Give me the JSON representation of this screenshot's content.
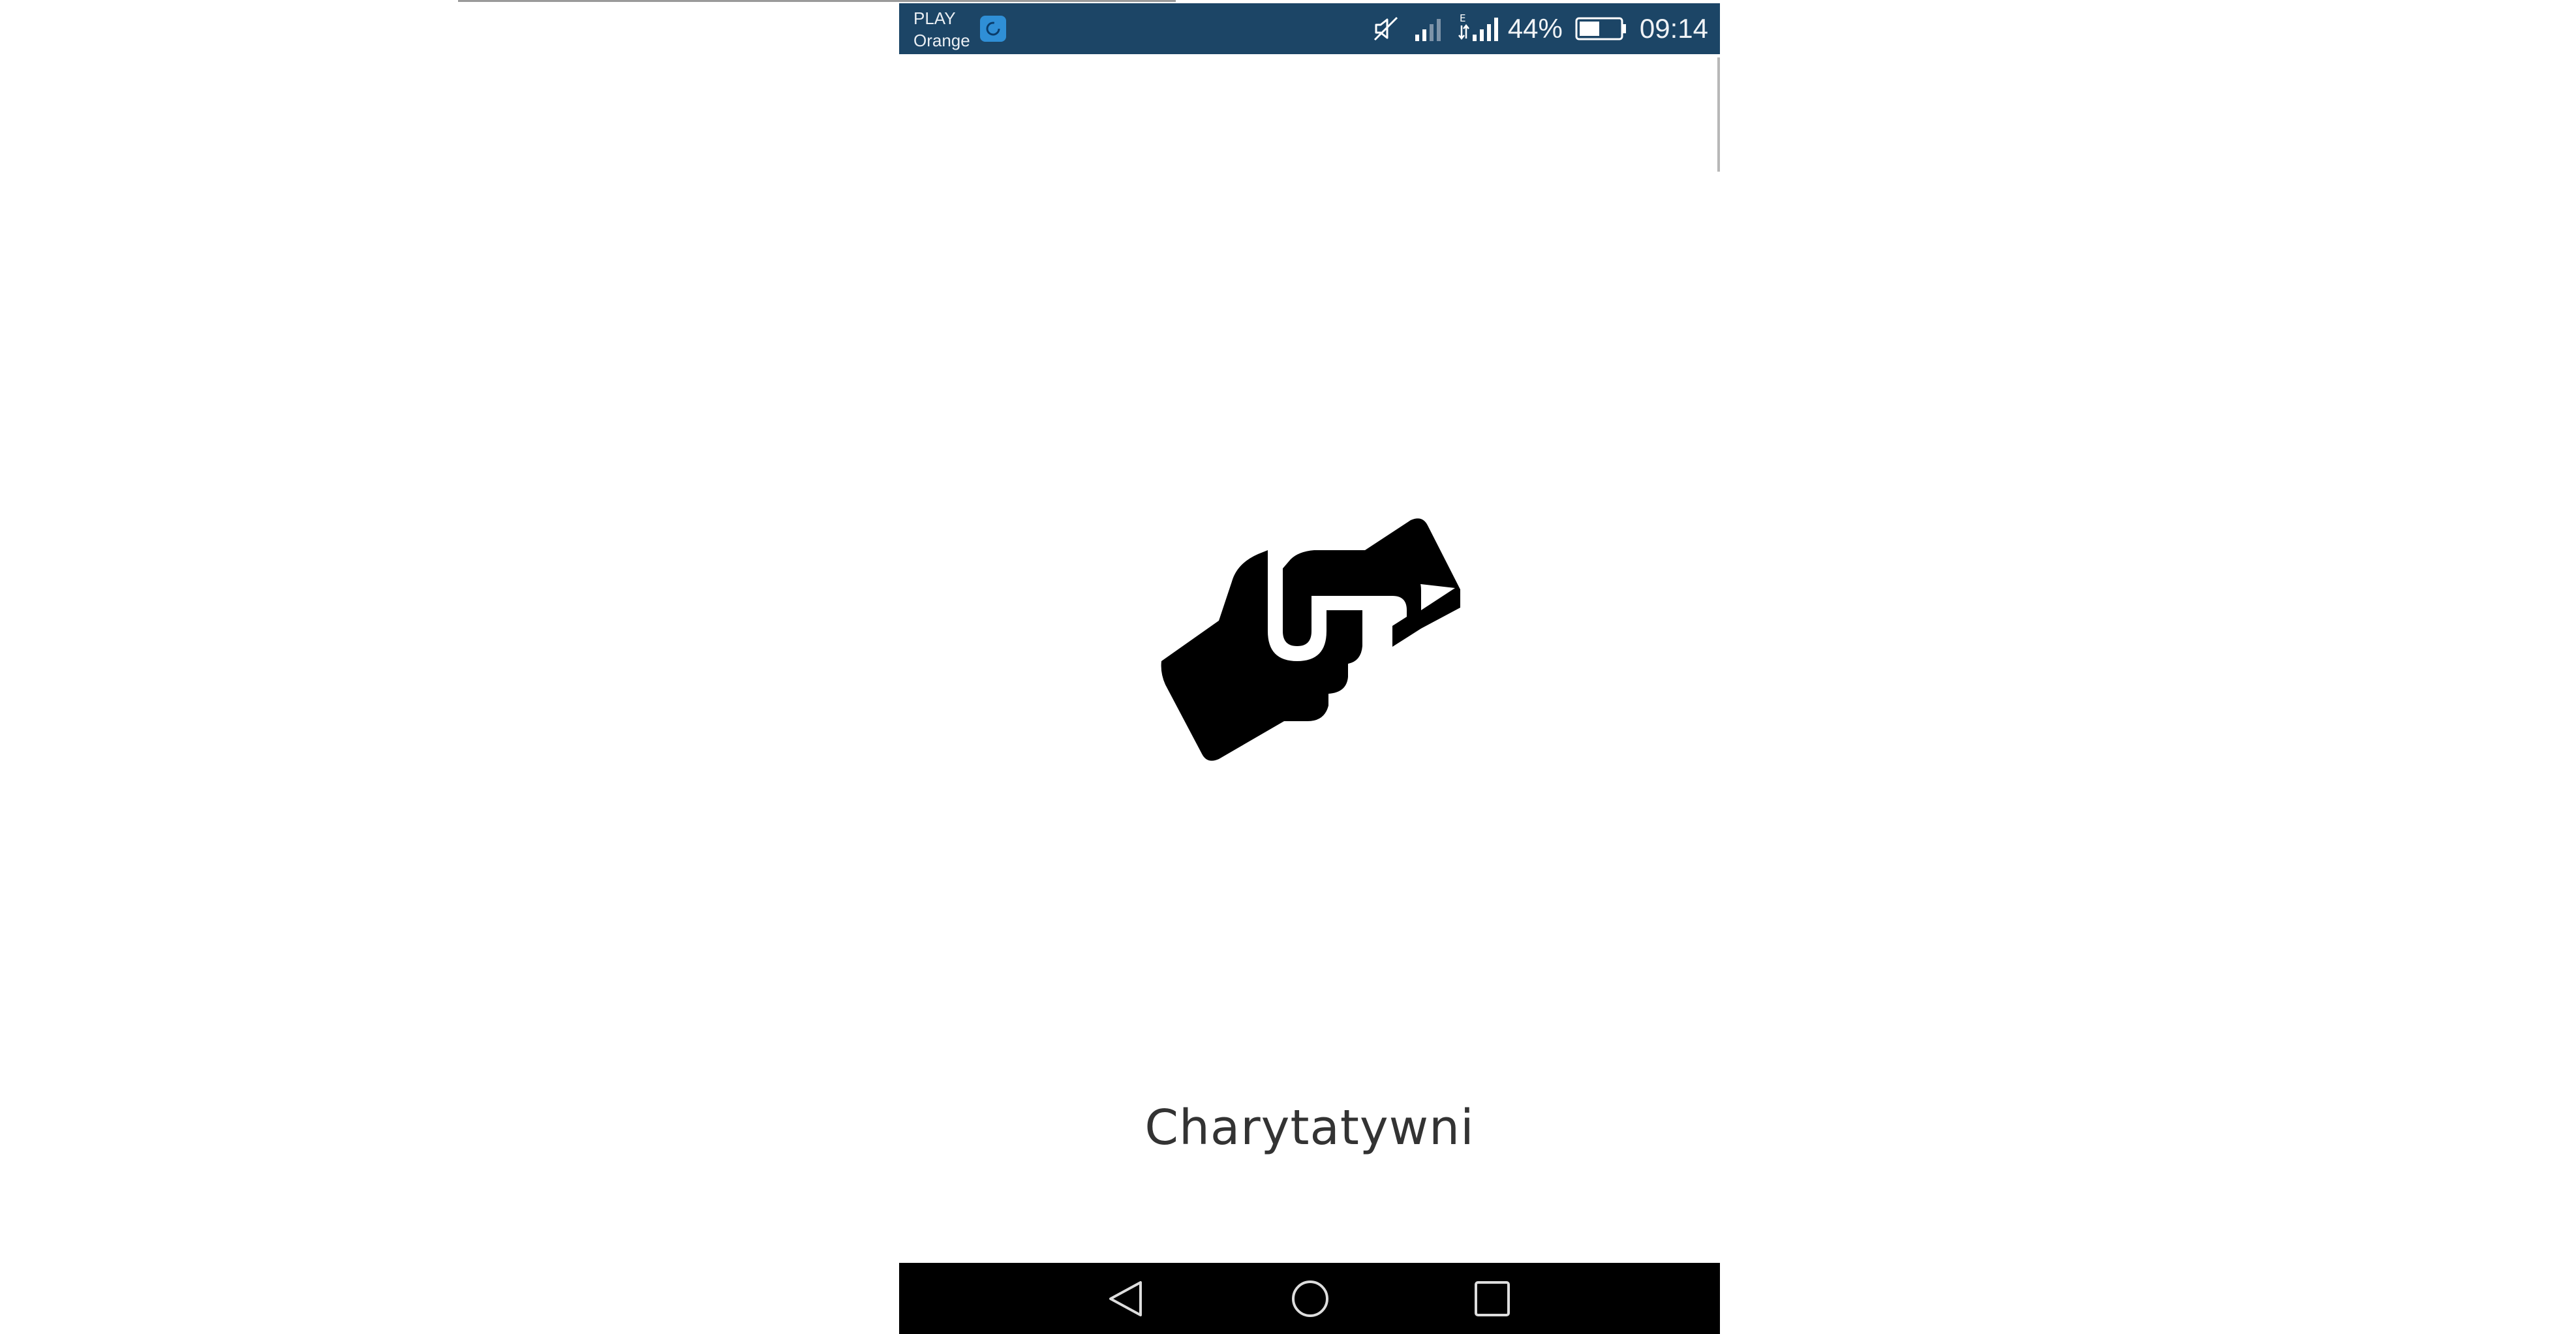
{
  "status_bar": {
    "carriers": [
      "PLAY",
      "Orange"
    ],
    "app_notification_icon": "app-notification-icon",
    "icons": [
      "mute-icon",
      "signal-weak-icon",
      "signal-e-icon",
      "battery-icon"
    ],
    "network_type": "E",
    "battery_percent": "44%",
    "time": "09:14",
    "background_color": "#1c4566"
  },
  "splash": {
    "icon": "handshake-icon",
    "app_name": "Charytatywni"
  },
  "nav_bar": {
    "buttons": [
      "back-button",
      "home-button",
      "recents-button"
    ],
    "background_color": "#000000"
  }
}
